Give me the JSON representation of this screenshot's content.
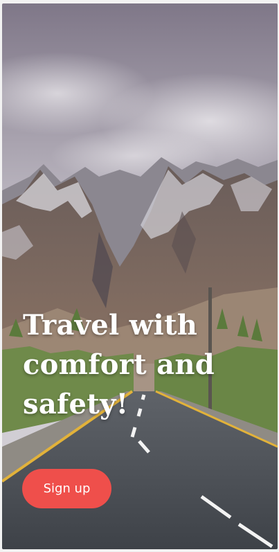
{
  "hero": {
    "headline_lines": [
      "Travel with",
      "comfort and",
      "safety!"
    ]
  },
  "cta": {
    "label": "Sign up"
  },
  "colors": {
    "accent": "#ef4f4b",
    "headline_text": "#ffffff"
  }
}
